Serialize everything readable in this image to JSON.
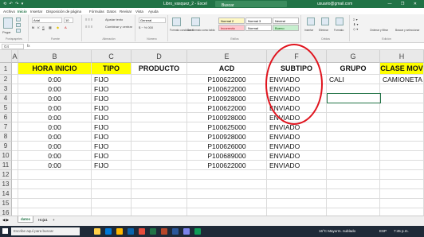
{
  "titlebar": {
    "quick_access": "⟲ ↶ ↷ ▾",
    "title": "Libro_vasquez_2 - Excel",
    "search_placeholder": "Buscar",
    "user": "usuario@gmail.com",
    "window_controls": "— ❐ ✕"
  },
  "menu": [
    "Archivo",
    "Inicio",
    "Insertar",
    "Disposición de página",
    "Fórmulas",
    "Datos",
    "Revisar",
    "Vista",
    "Ayuda"
  ],
  "ribbon": {
    "paste_label": "Pegar",
    "clipboard_label": "Portapapeles",
    "font_label": "Fuente",
    "font_name": "Arial",
    "font_size": "10",
    "alignment_label": "Alineación",
    "wrap_label": "Ajustar texto",
    "merge_label": "Combinar y centrar",
    "number_label": "Número",
    "number_format": "General",
    "styles_label": "Estilos",
    "cond_format_label": "Formato condicional",
    "as_table_label": "Dar formato como tabla",
    "style_normal2": "Normal 2",
    "style_normal3": "Normal 3",
    "style_bad": "Incorrecto",
    "style_good": "Bueno",
    "style_neutral": "Neutral",
    "style_normal": "Normal",
    "cells_label": "Celdas",
    "insert_label": "Insertar",
    "delete_label": "Eliminar",
    "format_label": "Formato",
    "editing_label": "Edición",
    "sort_label": "Ordenar y filtrar",
    "find_label": "Buscar y seleccionar"
  },
  "formula_bar": {
    "name_box": "G4",
    "fx": "fx",
    "content": ""
  },
  "grid": {
    "columns": [
      "A",
      "B",
      "C",
      "D",
      "E",
      "F",
      "G",
      "H"
    ],
    "rows": [
      "1",
      "2",
      "3",
      "4",
      "5",
      "6",
      "7",
      "8",
      "9",
      "10",
      "11",
      "12",
      "13",
      "14",
      "15",
      "16"
    ],
    "headers": {
      "hora": "HORA INICIO",
      "tipo": "TIPO",
      "producto": "PRODUCTO",
      "acd": "ACD",
      "subtipo": "SUBTIPO",
      "grupo": "GRUPO",
      "clase": "CLASE MOV"
    },
    "data": [
      {
        "hora": "0:00",
        "tipo": "FIJO",
        "acd": "P100622000",
        "subtipo": "ENVIADO",
        "grupo": "CALI",
        "clase": "CAMIONETA"
      },
      {
        "hora": "0:00",
        "tipo": "FIJO",
        "acd": "P100622000",
        "subtipo": "ENVIADO",
        "grupo": "",
        "clase": ""
      },
      {
        "hora": "0:00",
        "tipo": "FIJO",
        "acd": "P100928000",
        "subtipo": "ENVIADO",
        "grupo": "",
        "clase": ""
      },
      {
        "hora": "0:00",
        "tipo": "FIJO",
        "acd": "P100622000",
        "subtipo": "ENVIADO",
        "grupo": "",
        "clase": ""
      },
      {
        "hora": "0:00",
        "tipo": "FIJO",
        "acd": "P100928000",
        "subtipo": "ENVIADO",
        "grupo": "",
        "clase": ""
      },
      {
        "hora": "0:00",
        "tipo": "FIJO",
        "acd": "P100625000",
        "subtipo": "ENVIADO",
        "grupo": "",
        "clase": ""
      },
      {
        "hora": "0:00",
        "tipo": "FIJO",
        "acd": "P100928000",
        "subtipo": "ENVIADO",
        "grupo": "",
        "clase": ""
      },
      {
        "hora": "0:00",
        "tipo": "FIJO",
        "acd": "P100626000",
        "subtipo": "ENVIADO",
        "grupo": "",
        "clase": ""
      },
      {
        "hora": "0:00",
        "tipo": "FIJO",
        "acd": "P100689000",
        "subtipo": "ENVIADO",
        "grupo": "",
        "clase": ""
      },
      {
        "hora": "0:00",
        "tipo": "FIJO",
        "acd": "P100622000",
        "subtipo": "ENVIADO",
        "grupo": "",
        "clase": ""
      }
    ]
  },
  "sheets": {
    "active": "datos dia",
    "other": "Hoja1",
    "add": "+"
  },
  "taskbar": {
    "search_placeholder": "Escribe aquí para buscar",
    "weather": "16°C Mayorm. nublado",
    "time": "7:45 p.m.",
    "lang": "ESP"
  },
  "colors": {
    "excel_green": "#217346",
    "header_yellow": "#ffff00",
    "annotation_red": "#e0141e"
  }
}
